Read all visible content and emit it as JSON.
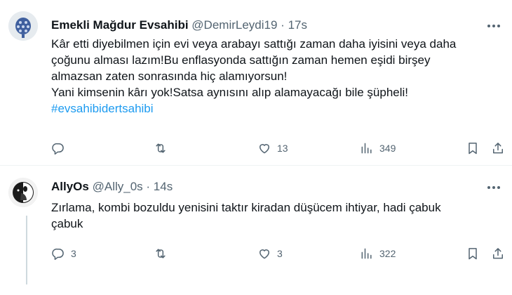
{
  "tweets": [
    {
      "name": "Emekli Mağdur Evsahibi",
      "handle": "@DemirLeydi19",
      "dot": "·",
      "time": "17s",
      "lines": [
        "Kâr etti diyebilmen için evi veya arabayı sattığı zaman daha iyisini veya daha",
        "çoğunu alması lazım!Bu enflasyonda sattığın zaman hemen eşidi birşey",
        "almazsan zaten sonrasında hiç alamıyorsun!",
        "Yani kimsenin kârı yok!Satsa aynısını alıp alamayacağı bile şüpheli!"
      ],
      "hashtag": "#evsahibidertsahibi",
      "replies": "",
      "retweets": "",
      "likes": "13",
      "views": "349"
    },
    {
      "name": "AllyOs",
      "handle": "@Ally_0s",
      "dot": "·",
      "time": "14s",
      "lines": [
        "Zırlama, kombi bozuldu yenisini taktır kiradan düşücem ihtiyar, hadi çabuk",
        "çabuk"
      ],
      "replies": "3",
      "retweets": "",
      "likes": "3",
      "views": "322"
    }
  ],
  "colors": {
    "text": "#0f1419",
    "secondary": "#536471",
    "link": "#1d9bf0",
    "divider": "#eff3f4"
  },
  "icons": [
    "more-icon",
    "reply-icon",
    "retweet-icon",
    "like-icon",
    "views-icon",
    "bookmark-icon",
    "share-icon"
  ]
}
